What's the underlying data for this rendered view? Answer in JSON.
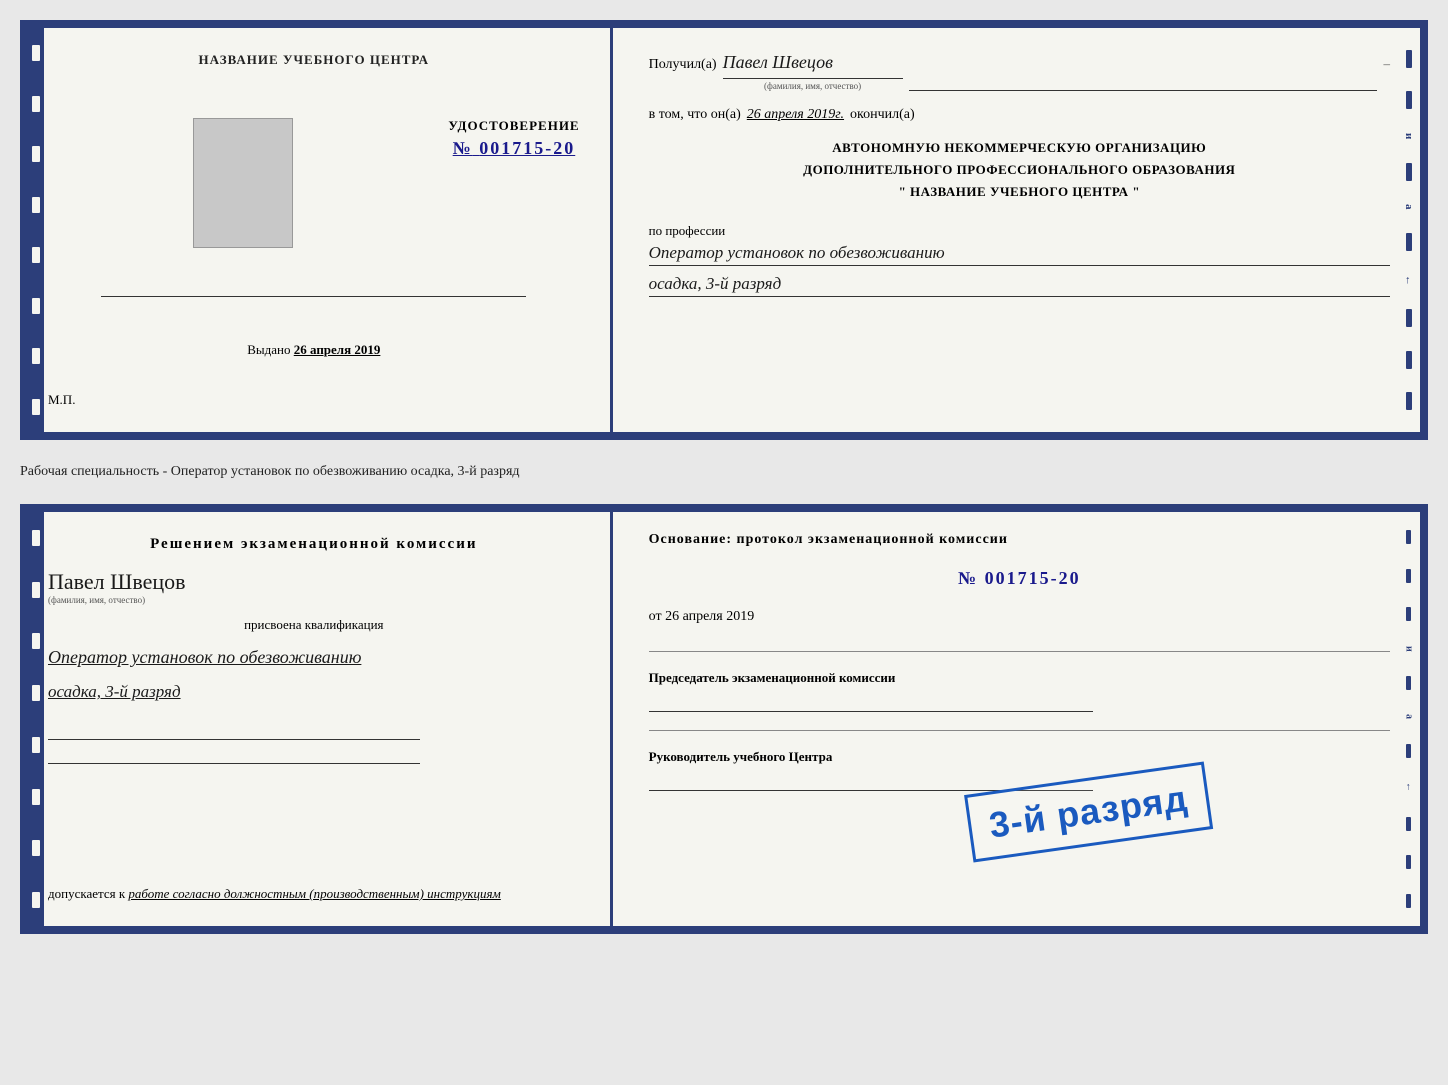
{
  "doc1": {
    "left": {
      "center_title": "НАЗВАНИЕ УЧЕБНОГО ЦЕНТРА",
      "cert_label": "УДОСТОВЕРЕНИЕ",
      "cert_prefix": "№",
      "cert_number": "001715-20",
      "issued_label": "Выдано",
      "issued_date": "26 апреля 2019",
      "mp_label": "М.П."
    },
    "right": {
      "received_label": "Получил(а)",
      "received_name": "Павел Швецов",
      "fio_hint": "(фамилия, имя, отчество)",
      "date_prefix": "в том, что он(а)",
      "date_value": "26 апреля 2019г.",
      "date_suffix": "окончил(а)",
      "org_line1": "АВТОНОМНУЮ НЕКОММЕРЧЕСКУЮ ОРГАНИЗАЦИЮ",
      "org_line2": "ДОПОЛНИТЕЛЬНОГО ПРОФЕССИОНАЛЬНОГО ОБРАЗОВАНИЯ",
      "org_line3": "\"  НАЗВАНИЕ УЧЕБНОГО ЦЕНТРА  \"",
      "profession_label": "по профессии",
      "profession_value": "Оператор установок по обезвоживанию",
      "profession_rank": "осадка, 3-й разряд"
    }
  },
  "specialty_description": "Рабочая специальность - Оператор установок по обезвоживанию осадка, 3-й разряд",
  "doc2": {
    "left": {
      "decision_title": "Решением экзаменационной комиссии",
      "person_name": "Павел Швецов",
      "fio_hint": "(фамилия, имя, отчество)",
      "assigned_label": "присвоена квалификация",
      "profession_value": "Оператор установок по обезвоживанию",
      "rank_value": "осадка, 3-й разряд",
      "допускается_label": "допускается к",
      "допускается_value": "работе согласно должностным (производственным) инструкциям"
    },
    "right": {
      "basis_title": "Основание: протокол экзаменационной комиссии",
      "protocol_prefix": "№",
      "protocol_number": "001715-20",
      "date_prefix": "от",
      "date_value": "26 апреля 2019",
      "chairman_label": "Председатель экзаменационной комиссии",
      "director_label": "Руководитель учебного Центра"
    },
    "stamp_text": "3-й разряд"
  }
}
